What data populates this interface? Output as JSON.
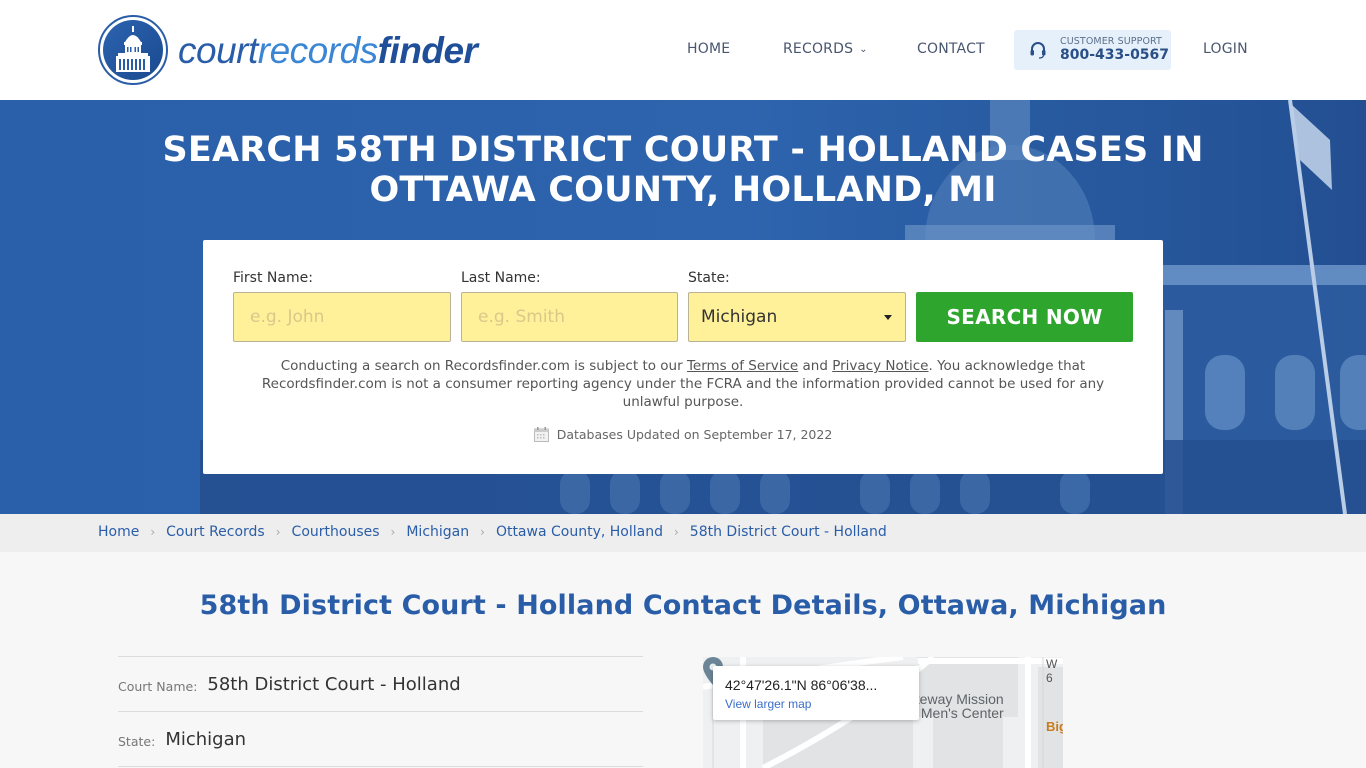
{
  "header": {
    "logo": {
      "part1": "court",
      "part2": "records",
      "part3": "finder"
    },
    "nav": [
      {
        "label": "HOME"
      },
      {
        "label": "RECORDS",
        "has_dropdown": true
      },
      {
        "label": "CONTACT"
      }
    ],
    "support": {
      "label": "CUSTOMER SUPPORT",
      "phone": "800-433-0567",
      "icon": "headset-icon"
    },
    "login_label": "LOGIN"
  },
  "hero": {
    "title": "SEARCH 58TH DISTRICT COURT - HOLLAND CASES IN OTTAWA COUNTY, HOLLAND, MI"
  },
  "search": {
    "first_name_label": "First Name:",
    "first_name_placeholder": "e.g. John",
    "first_name_value": "",
    "last_name_label": "Last Name:",
    "last_name_placeholder": "e.g. Smith",
    "last_name_value": "",
    "state_label": "State:",
    "state_value": "Michigan",
    "submit_label": "SEARCH NOW",
    "disclaimer_pre": "Conducting a search on Recordsfinder.com is subject to our ",
    "terms_link": "Terms of Service",
    "disclaimer_mid": " and ",
    "privacy_link": "Privacy Notice",
    "disclaimer_post": ". You acknowledge that Recordsfinder.com is not a consumer reporting agency under the FCRA and the information provided cannot be used for any unlawful purpose.",
    "db_updated": "Databases Updated on September 17, 2022"
  },
  "breadcrumb": [
    "Home",
    "Court Records",
    "Courthouses",
    "Michigan",
    "Ottawa County, Holland",
    "58th District Court - Holland"
  ],
  "main": {
    "title": "58th District Court - Holland Contact Details, Ottawa, Michigan",
    "details": [
      {
        "label": "Court Name:",
        "value": "58th District Court - Holland"
      },
      {
        "label": "State:",
        "value": "Michigan"
      }
    ],
    "map": {
      "coords": "42°47'26.1\"N 86°06'38...",
      "link": "View larger map",
      "poi_line1": "ateway Mission",
      "poi_line2": "Men's Center",
      "poi2": "Big",
      "road": "W 6"
    }
  },
  "colors": {
    "brand_blue": "#2a5da8",
    "search_green": "#2ea52c",
    "input_yellow": "#fff09a",
    "support_bg": "#e6f0fb"
  }
}
